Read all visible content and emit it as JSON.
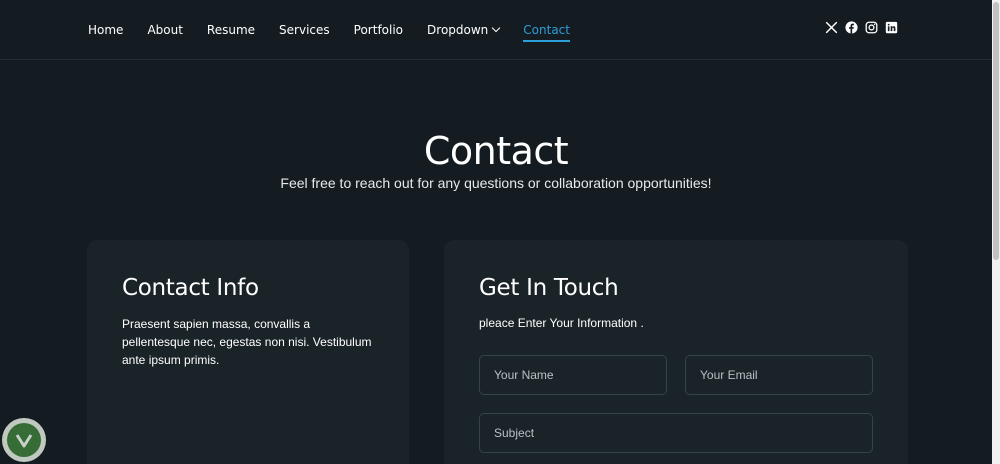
{
  "nav": {
    "items": [
      {
        "label": "Home"
      },
      {
        "label": "About"
      },
      {
        "label": "Resume"
      },
      {
        "label": "Services"
      },
      {
        "label": "Portfolio"
      },
      {
        "label": "Dropdown"
      },
      {
        "label": "Contact"
      }
    ],
    "active": "Contact"
  },
  "social": [
    "x-icon",
    "facebook-icon",
    "instagram-icon",
    "linkedin-icon"
  ],
  "section": {
    "title": "Contact",
    "subtitle": "Feel free to reach out for any questions or collaboration opportunities!"
  },
  "contact_info": {
    "title": "Contact Info",
    "text": "Praesent sapien massa, convallis a pellentesque nec, egestas non nisi. Vestibulum ante ipsum primis."
  },
  "get_in_touch": {
    "title": "Get In Touch",
    "text": "pleace Enter Your Information .",
    "name_placeholder": "Your Name",
    "email_placeholder": "Your Email",
    "subject_placeholder": "Subject"
  },
  "colors": {
    "background": "#141c22",
    "card": "#1a2328",
    "accent": "#2d9fd9",
    "border": "#36424a"
  }
}
